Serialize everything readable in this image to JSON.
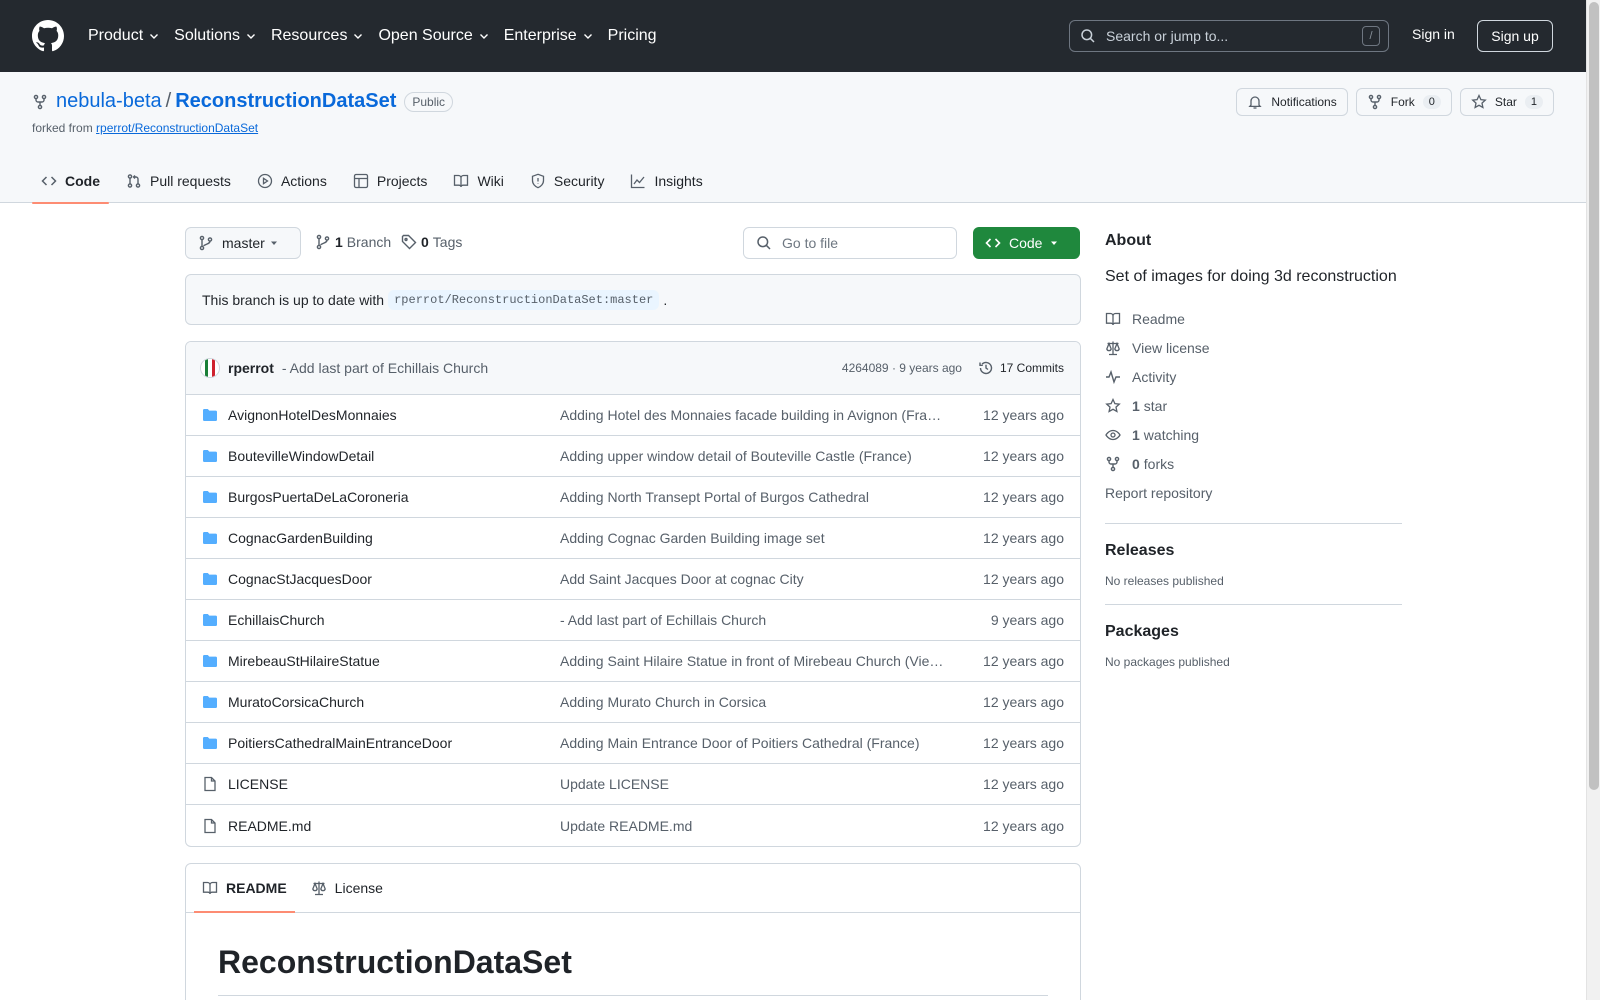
{
  "header": {
    "nav": [
      "Product",
      "Solutions",
      "Resources",
      "Open Source",
      "Enterprise",
      "Pricing"
    ],
    "search_placeholder": "Search or jump to...",
    "search_shortcut": "/",
    "signin": "Sign in",
    "signup": "Sign up"
  },
  "repo": {
    "owner": "nebula-beta",
    "separator": "/",
    "name": "ReconstructionDataSet",
    "visibility": "Public",
    "forked_prefix": "forked from",
    "forked_source": "rperrot/ReconstructionDataSet",
    "actions": {
      "notifications": "Notifications",
      "fork": "Fork",
      "fork_count": "0",
      "star": "Star",
      "star_count": "1"
    },
    "tabs": [
      "Code",
      "Pull requests",
      "Actions",
      "Projects",
      "Wiki",
      "Security",
      "Insights"
    ]
  },
  "toolbar": {
    "branch": "master",
    "branch_count": "1",
    "branch_label": "Branch",
    "tag_count": "0",
    "tag_label": "Tags",
    "goto_placeholder": "Go to file",
    "code_button": "Code"
  },
  "status": {
    "prefix": "This branch is up to date with",
    "ref": "rperrot/ReconstructionDataSet:master",
    "suffix": "."
  },
  "latest_commit": {
    "author": "rperrot",
    "message": "- Add last part of Echillais Church",
    "meta": "4264089 · 9 years ago",
    "commits": "17 Commits"
  },
  "files": [
    {
      "type": "dir",
      "name": "AvignonHotelDesMonnaies",
      "message": "Adding Hotel des Monnaies facade building in Avignon (France)",
      "age": "12 years ago"
    },
    {
      "type": "dir",
      "name": "BoutevilleWindowDetail",
      "message": "Adding upper window detail of Bouteville Castle (France)",
      "age": "12 years ago"
    },
    {
      "type": "dir",
      "name": "BurgosPuertaDeLaCoroneria",
      "message": "Adding North Transept Portal of Burgos Cathedral",
      "age": "12 years ago"
    },
    {
      "type": "dir",
      "name": "CognacGardenBuilding",
      "message": "Adding Cognac Garden Building image set",
      "age": "12 years ago"
    },
    {
      "type": "dir",
      "name": "CognacStJacquesDoor",
      "message": "Add Saint Jacques Door at cognac City",
      "age": "12 years ago"
    },
    {
      "type": "dir",
      "name": "EchillaisChurch",
      "message": "- Add last part of Echillais Church",
      "age": "9 years ago"
    },
    {
      "type": "dir",
      "name": "MirebeauStHilaireStatue",
      "message": "Adding Saint Hilaire Statue in front of Mirebeau Church (Vienne, France)",
      "age": "12 years ago"
    },
    {
      "type": "dir",
      "name": "MuratoCorsicaChurch",
      "message": "Adding Murato Church in Corsica",
      "age": "12 years ago"
    },
    {
      "type": "dir",
      "name": "PoitiersCathedralMainEntranceDoor",
      "message": "Adding Main Entrance Door of Poitiers Cathedral (France)",
      "age": "12 years ago"
    },
    {
      "type": "file",
      "name": "LICENSE",
      "message": "Update LICENSE",
      "age": "12 years ago"
    },
    {
      "type": "file",
      "name": "README.md",
      "message": "Update README.md",
      "age": "12 years ago"
    }
  ],
  "readme": {
    "tabs": [
      "README",
      "License"
    ],
    "heading": "ReconstructionDataSet"
  },
  "sidebar": {
    "about_title": "About",
    "description": "Set of images for doing 3d reconstruction",
    "links": {
      "readme": "Readme",
      "license": "View license",
      "activity": "Activity",
      "stars_count": "1",
      "stars_label": "star",
      "watching_count": "1",
      "watching_label": "watching",
      "forks_count": "0",
      "forks_label": "forks",
      "report": "Report repository"
    },
    "releases_title": "Releases",
    "releases_note": "No releases published",
    "packages_title": "Packages",
    "packages_note": "No packages published"
  },
  "colors": {
    "header_bg": "#24292f",
    "link": "#0969da",
    "code_button": "#1f883d",
    "active_tab_underline": "#fd8c73",
    "folder": "#54aeff"
  }
}
